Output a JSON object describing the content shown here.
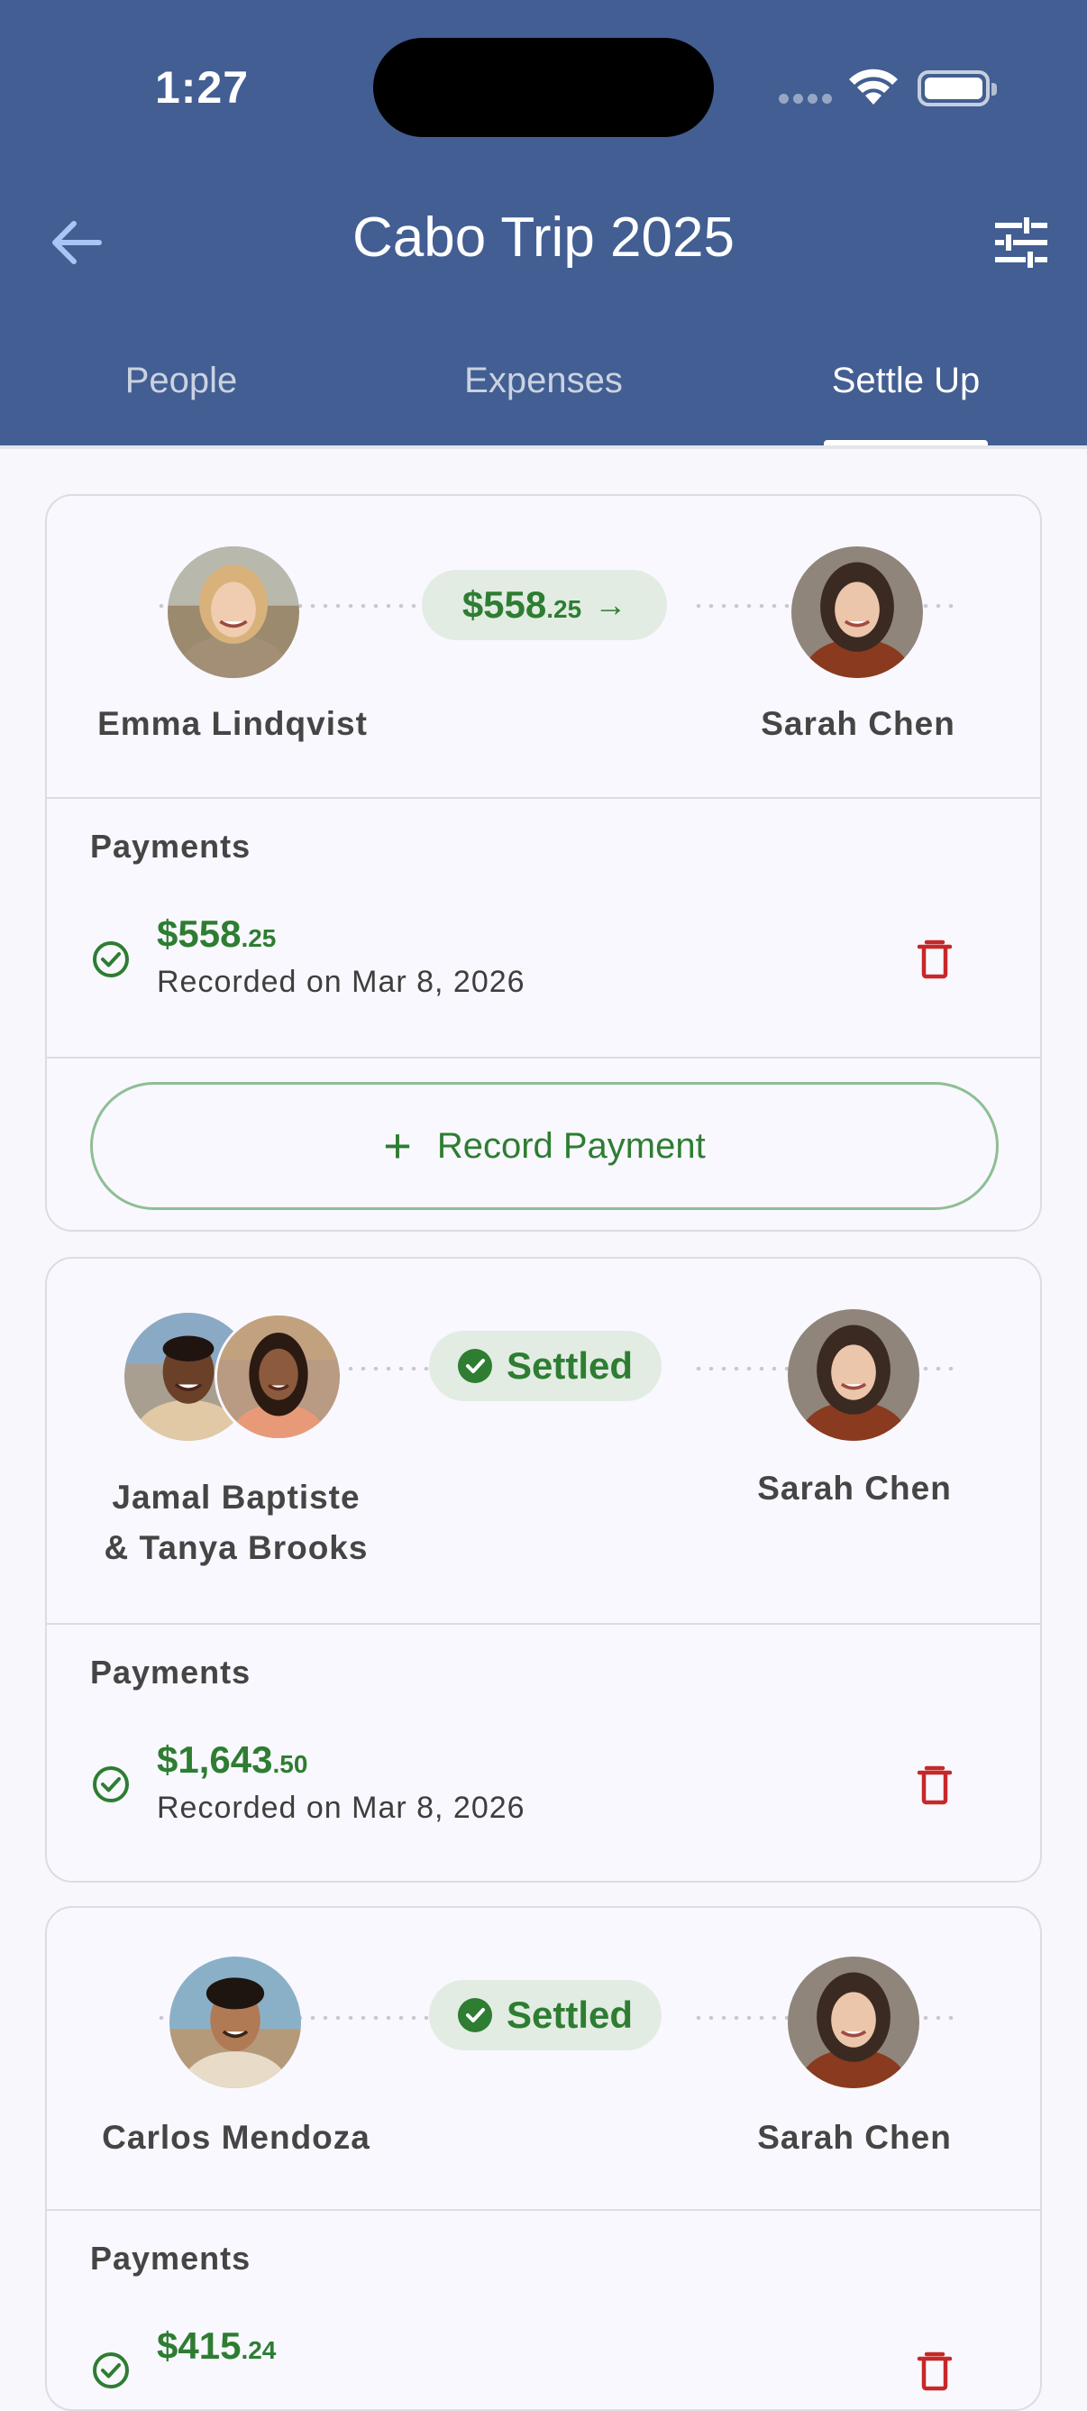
{
  "status_bar": {
    "time": "1:27"
  },
  "header": {
    "title": "Cabo Trip 2025",
    "back_icon": "arrow-left-icon",
    "filter_icon": "sliders-icon"
  },
  "tabs": [
    {
      "label": "People",
      "active": false
    },
    {
      "label": "Expenses",
      "active": false
    },
    {
      "label": "Settle Up",
      "active": true
    }
  ],
  "colors": {
    "header_bg": "#425e92",
    "accent_green": "#2e7d32",
    "pill_bg": "#e2ece3",
    "delete_red": "#c62828",
    "card_bg": "#f8f8fe"
  },
  "settlements": [
    {
      "from_name": "Emma Lindqvist",
      "to_name": "Sarah Chen",
      "amount_main": "$558",
      "amount_cents": ".25",
      "arrow": "→",
      "payments_label": "Payments",
      "payments": [
        {
          "amount_main": "$558",
          "amount_cents": ".25",
          "date": "Recorded on Mar 8, 2026"
        }
      ],
      "record_button": {
        "plus": "+",
        "label": "Record Payment"
      }
    },
    {
      "from_name_line1": "Jamal Baptiste",
      "from_name_line2": "& Tanya Brooks",
      "to_name": "Sarah Chen",
      "status": "Settled",
      "payments_label": "Payments",
      "payments": [
        {
          "amount_main": "$1,643",
          "amount_cents": ".50",
          "date": "Recorded on Mar 8, 2026"
        }
      ]
    },
    {
      "from_name": "Carlos Mendoza",
      "to_name": "Sarah Chen",
      "status": "Settled",
      "payments_label": "Payments",
      "payments": [
        {
          "amount_main": "$415",
          "amount_cents": ".24"
        }
      ]
    }
  ]
}
